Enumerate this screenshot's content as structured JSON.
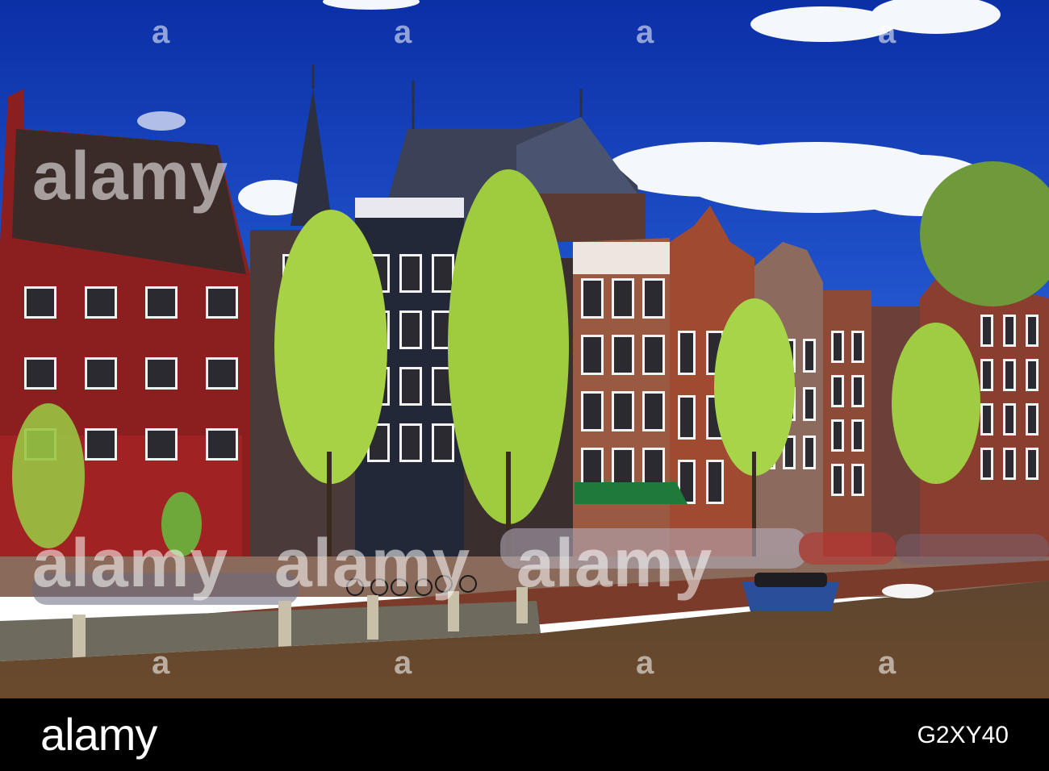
{
  "photo": {
    "subject": "canal-houses",
    "colors": {
      "sky": "#1846c8",
      "water": "#6b4a2e",
      "red_house": "#8e2020",
      "brick": "#8a4b35",
      "dark_house": "#2a2f3f",
      "tree": "#a6d145",
      "awning": "#1d7a3a",
      "boat": "#2a4e9a"
    }
  },
  "watermark": {
    "word": "alamy",
    "mark": "a"
  },
  "footer": {
    "brand": "alamy",
    "image_id": "G2XY40",
    "background": "#000000"
  }
}
